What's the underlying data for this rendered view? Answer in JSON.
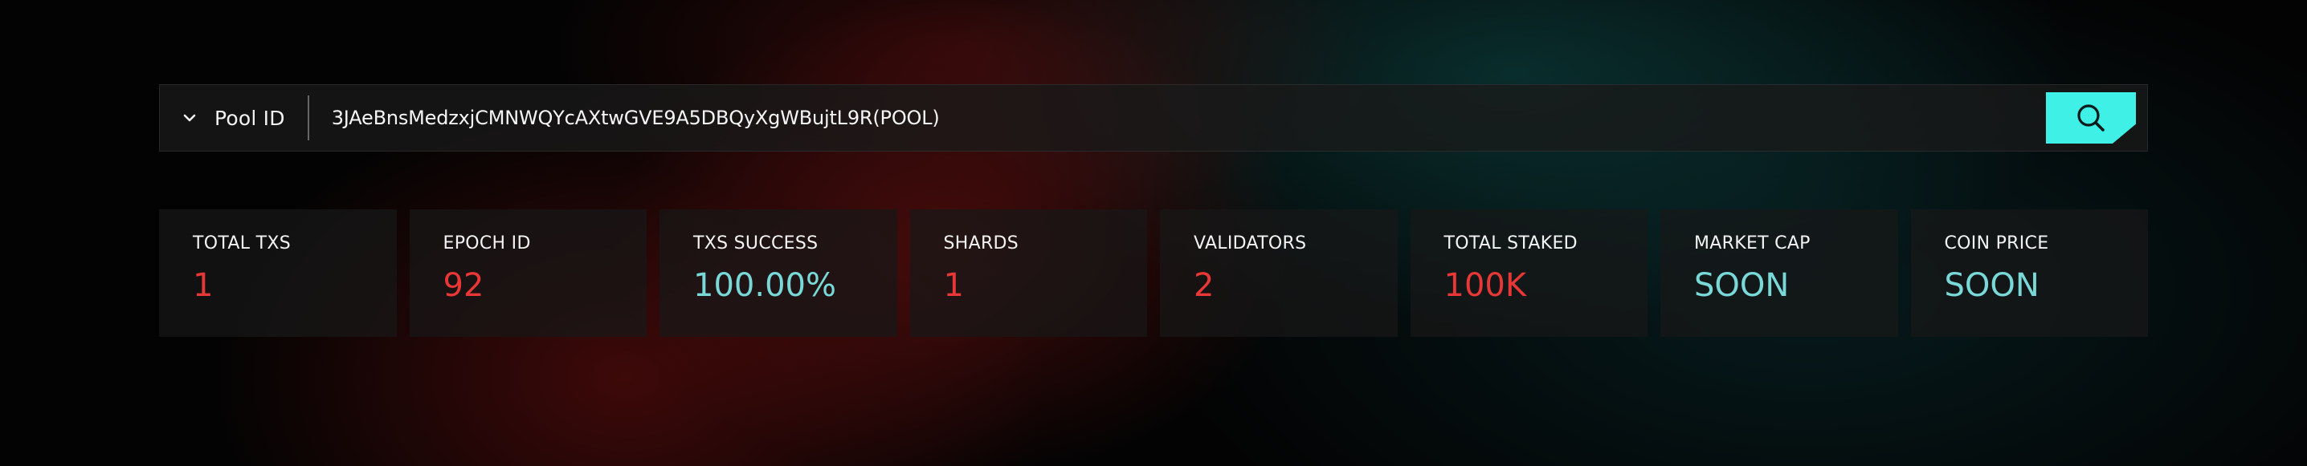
{
  "search": {
    "selector_label": "Pool ID",
    "query": "3JAeBnsMedzxjCMNWQYcAXtwGVE9A5DBQyXgWBujtL9R(POOL)",
    "selector_icon": "chevron-down-icon",
    "button_icon": "search-icon",
    "button_color": "#3ef0e6"
  },
  "stats": [
    {
      "label": "TOTAL TXS",
      "value": "1",
      "color": "#e83737"
    },
    {
      "label": "EPOCH ID",
      "value": "92",
      "color": "#e83737"
    },
    {
      "label": "TXS SUCCESS",
      "value": "100.00%",
      "color": "#79d8d8"
    },
    {
      "label": "SHARDS",
      "value": "1",
      "color": "#e83737"
    },
    {
      "label": "VALIDATORS",
      "value": "2",
      "color": "#e83737"
    },
    {
      "label": "TOTAL STAKED",
      "value": "100K",
      "color": "#e83737"
    },
    {
      "label": "MARKET CAP",
      "value": "SOON",
      "color": "#79d8d8"
    },
    {
      "label": "COIN PRICE",
      "value": "SOON",
      "color": "#79d8d8"
    }
  ]
}
